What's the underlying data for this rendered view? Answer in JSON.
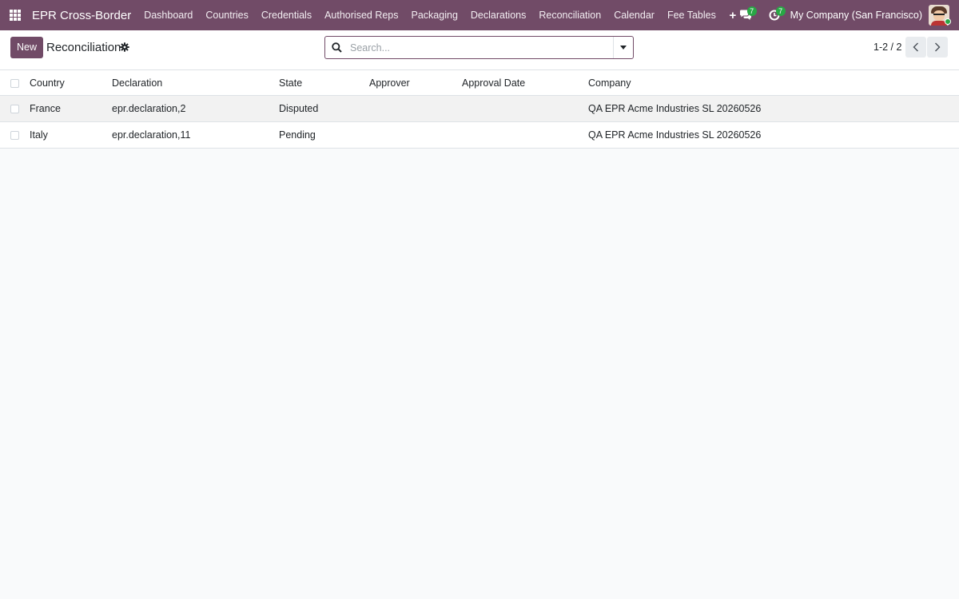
{
  "navbar": {
    "app_title": "EPR Cross-Border",
    "menu": [
      {
        "label": "Dashboard"
      },
      {
        "label": "Countries"
      },
      {
        "label": "Credentials"
      },
      {
        "label": "Authorised Reps"
      },
      {
        "label": "Packaging"
      },
      {
        "label": "Declarations"
      },
      {
        "label": "Reconciliation"
      },
      {
        "label": "Calendar"
      },
      {
        "label": "Fee Tables"
      }
    ],
    "messages_count": "7",
    "activities_count": "7",
    "company": "My Company (San Francisco)"
  },
  "control": {
    "new_label": "New",
    "title": "Reconciliation",
    "search_placeholder": "Search...",
    "pager": "1-2 / 2"
  },
  "table": {
    "columns": [
      "Country",
      "Declaration",
      "State",
      "Approver",
      "Approval Date",
      "Company"
    ],
    "rows": [
      {
        "country": "France",
        "declaration": "epr.declaration,2",
        "state": "Disputed",
        "approver": "",
        "approval_date": "",
        "company": "QA EPR Acme Industries SL 20260526"
      },
      {
        "country": "Italy",
        "declaration": "epr.declaration,11",
        "state": "Pending",
        "approver": "",
        "approval_date": "",
        "company": "QA EPR Acme Industries SL 20260526"
      }
    ]
  },
  "colors": {
    "brand": "#714b67",
    "badge": "#28a745"
  }
}
